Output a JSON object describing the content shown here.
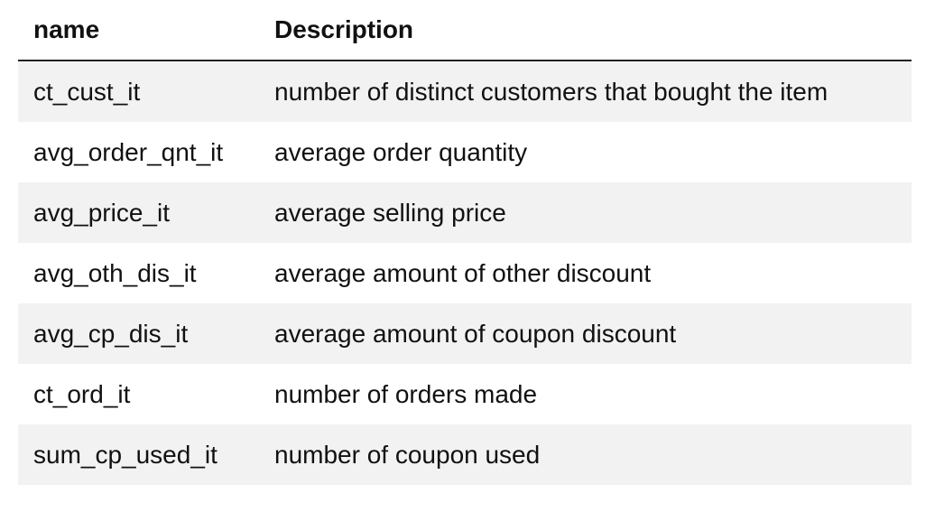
{
  "table": {
    "headers": [
      "name",
      "Description"
    ],
    "rows": [
      {
        "name": "ct_cust_it",
        "description": "number of distinct customers that bought the item"
      },
      {
        "name": "avg_order_qnt_it",
        "description": "average order quantity"
      },
      {
        "name": "avg_price_it",
        "description": "average selling price"
      },
      {
        "name": "avg_oth_dis_it",
        "description": "average amount of other discount"
      },
      {
        "name": "avg_cp_dis_it",
        "description": "average amount of coupon discount"
      },
      {
        "name": "ct_ord_it",
        "description": "number of orders made"
      },
      {
        "name": "sum_cp_used_it",
        "description": "number of coupon used"
      }
    ]
  },
  "colors": {
    "stripe": "#f2f2f2",
    "header_rule": "#222222"
  }
}
